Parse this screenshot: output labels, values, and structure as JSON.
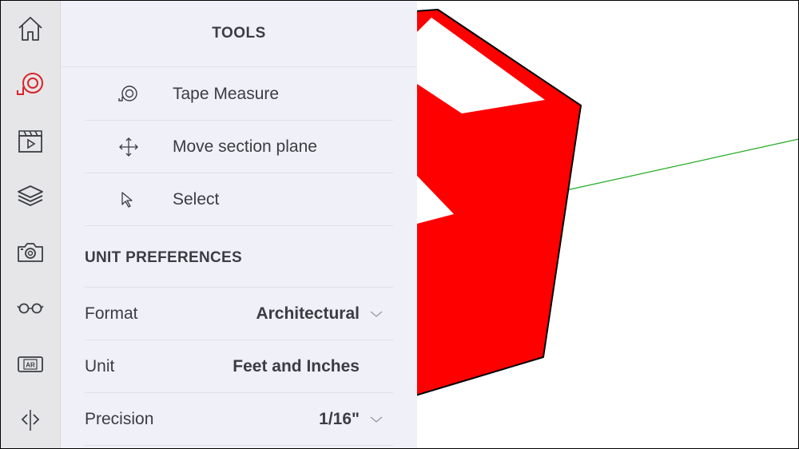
{
  "rail": {
    "items": [
      {
        "name": "home",
        "icon": "home-icon"
      },
      {
        "name": "tape-measure",
        "icon": "tape-measure-icon",
        "active": true
      },
      {
        "name": "scenes",
        "icon": "clapperboard-play-icon"
      },
      {
        "name": "layers",
        "icon": "layers-icon"
      },
      {
        "name": "camera",
        "icon": "camera-icon"
      },
      {
        "name": "viewing",
        "icon": "glasses-icon"
      },
      {
        "name": "ar",
        "icon": "ar-icon",
        "text": "AR"
      },
      {
        "name": "section",
        "icon": "section-plane-icon"
      }
    ],
    "accent": "#d8232a"
  },
  "panel": {
    "title": "TOOLS",
    "tools": [
      {
        "label": "Tape Measure",
        "icon": "tape-measure-icon"
      },
      {
        "label": "Move section plane",
        "icon": "move-arrows-icon"
      },
      {
        "label": "Select",
        "icon": "cursor-arrow-icon"
      }
    ],
    "unit_heading": "UNIT PREFERENCES",
    "prefs": [
      {
        "label": "Format",
        "value": "Architectural",
        "dropdown": true
      },
      {
        "label": "Unit",
        "value": "Feet and Inches",
        "dropdown": false
      },
      {
        "label": "Precision",
        "value": "1/16\"",
        "dropdown": true
      }
    ]
  },
  "viewport": {
    "model_color": "#ff0000",
    "axis_color": "#22aa22"
  }
}
